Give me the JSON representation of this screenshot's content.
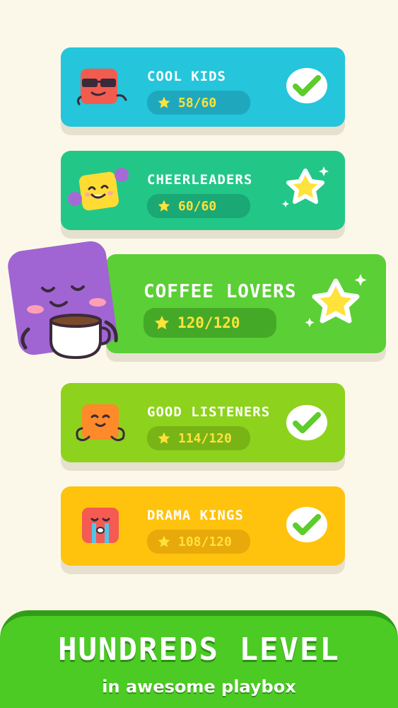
{
  "levels": [
    {
      "name": "COOL KIDS",
      "score": "58/60",
      "status": "completed",
      "color": "#25c5db",
      "mascot": "sunglasses-red-square"
    },
    {
      "name": "CHEERLEADERS",
      "score": "60/60",
      "status": "perfect",
      "color": "#22c788",
      "mascot": "yellow-square-pompoms"
    },
    {
      "name": "COFFEE LOVERS",
      "score": "120/120",
      "status": "perfect",
      "color": "#5bcf36",
      "mascot": "purple-square-coffee-cup"
    },
    {
      "name": "GOOD LISTENERS",
      "score": "114/120",
      "status": "completed",
      "color": "#8dd21c",
      "mascot": "orange-square-smiling"
    },
    {
      "name": "DRAMA KINGS",
      "score": "108/120",
      "status": "completed",
      "color": "#ffc30e",
      "mascot": "red-square-crying"
    }
  ],
  "banner": {
    "headline": "HUNDREDS LEVEL",
    "subline": "in awesome playbox"
  },
  "icons": {
    "check": "check-icon",
    "star": "star-icon",
    "sparkle": "sparkle-icon"
  }
}
